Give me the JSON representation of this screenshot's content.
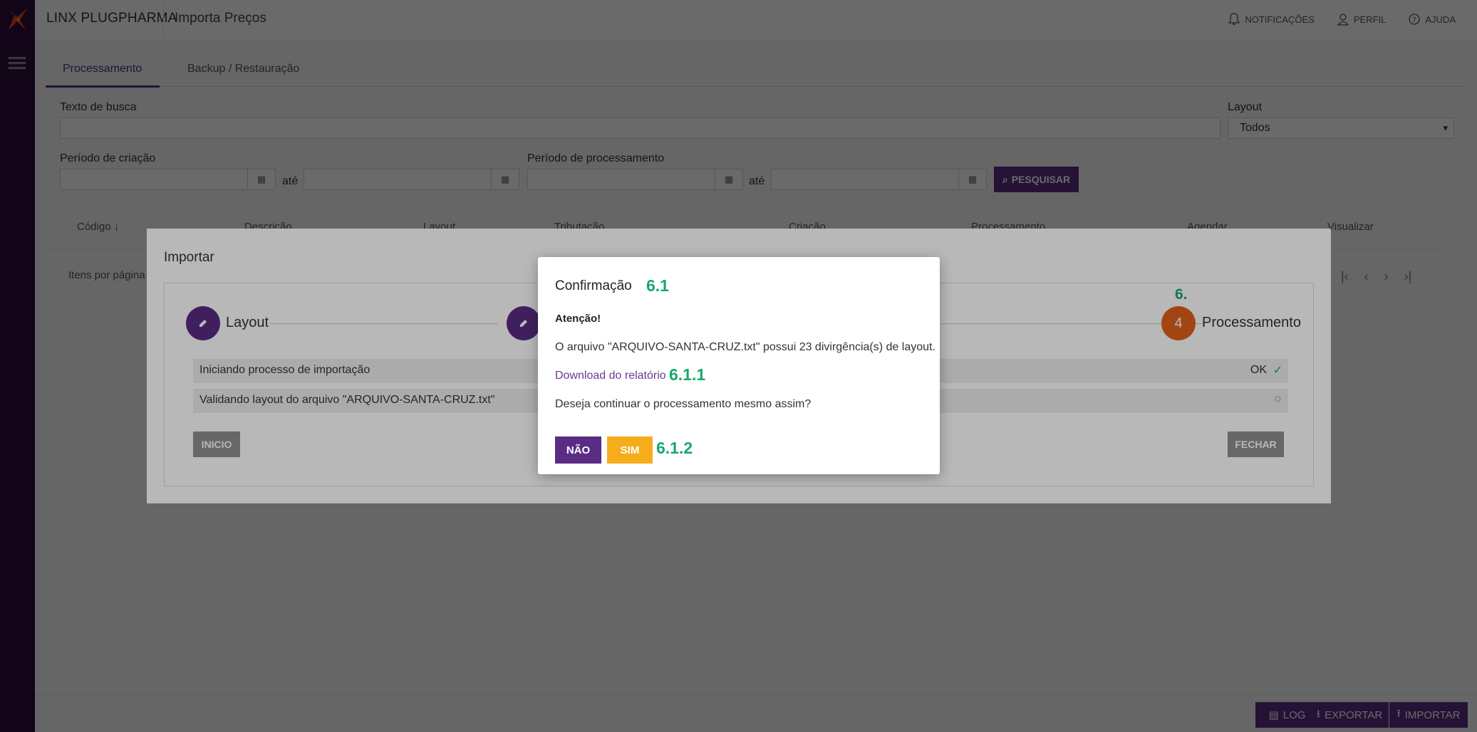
{
  "app": {
    "brand": "LINX PLUGPHARMA",
    "page_title": "Importa Preços",
    "top_links": [
      {
        "label": "NOTIFICAÇÕES",
        "icon": "bell-icon"
      },
      {
        "label": "PERFIL",
        "icon": "user-icon"
      },
      {
        "label": "AJUDA",
        "icon": "help-circle-icon"
      }
    ],
    "accent_color": "#5b2c83",
    "sidebar_color": "#2a0f3a"
  },
  "tabs": [
    {
      "label": "Processamento",
      "active": true
    },
    {
      "label": "Backup / Restauração",
      "active": false
    }
  ],
  "filters": {
    "search_label": "Texto de busca",
    "search_value": "",
    "layout_label": "Layout",
    "layout_value": "Todos",
    "creation_period_label": "Período de criação",
    "processing_period_label": "Período de processamento",
    "until_label": "até",
    "search_button": "PESQUISAR"
  },
  "table": {
    "columns": [
      "Código",
      "Descrição",
      "Layout",
      "Tributação",
      "Criação",
      "Processamento",
      "Agendar",
      "Visualizar"
    ],
    "items_per_page_label": "Itens por página"
  },
  "footer_buttons": [
    "LOG",
    "EXPORTAR",
    "IMPORTAR"
  ],
  "import_modal": {
    "title": "Importar",
    "steps": [
      {
        "label": "Layout",
        "icon": "pencil-icon"
      },
      {
        "label": "",
        "icon": "pencil-icon"
      },
      {
        "label": "Processamento",
        "number": "4",
        "annotation": "6."
      }
    ],
    "rows": [
      {
        "text": "Iniciando processo de importação",
        "status": "OK",
        "state": "done"
      },
      {
        "text": "Validando layout do arquivo \"ARQUIVO-SANTA-CRUZ.txt\"",
        "status": "",
        "state": "loading"
      }
    ],
    "start_button": "INICIO",
    "close_button": "FECHAR",
    "active_step_color": "#e0611a"
  },
  "dialog": {
    "title": "Confirmação",
    "title_annotation": "6.1",
    "attention": "Atenção!",
    "message": "O arquivo \"ARQUIVO-SANTA-CRUZ.txt\" possui 23 divirgência(s) de layout.",
    "link": "Download do relatório",
    "link_annotation": "6.1.1",
    "question": "Deseja continuar o processamento mesmo assim?",
    "no_button": "NÃO",
    "yes_button": "SIM",
    "buttons_annotation": "6.1.2",
    "yes_color": "#f6ad1b",
    "annotation_color": "#1aa86d"
  }
}
